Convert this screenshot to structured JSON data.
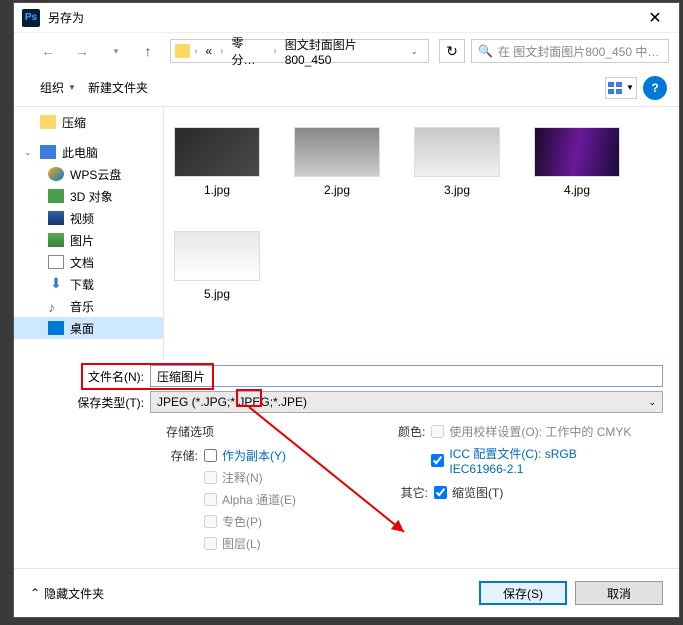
{
  "titlebar": {
    "title": "另存为",
    "app_icon": "Ps"
  },
  "nav": {
    "crumbs": [
      "«",
      "零分…",
      "图文封面图片800_450"
    ],
    "search_placeholder": "在 图文封面图片800_450 中…"
  },
  "toolbar": {
    "organize": "组织",
    "new_folder": "新建文件夹"
  },
  "sidebar": {
    "items": [
      {
        "label": "压缩",
        "icon": "folder",
        "level": "root"
      },
      {
        "label": "此电脑",
        "icon": "pc",
        "level": "root",
        "expandable": true
      },
      {
        "label": "WPS云盘",
        "icon": "cloud",
        "level": "child"
      },
      {
        "label": "3D 对象",
        "icon": "3d",
        "level": "child"
      },
      {
        "label": "视频",
        "icon": "video",
        "level": "child"
      },
      {
        "label": "图片",
        "icon": "pic",
        "level": "child"
      },
      {
        "label": "文档",
        "icon": "doc",
        "level": "child"
      },
      {
        "label": "下载",
        "icon": "dl",
        "level": "child"
      },
      {
        "label": "音乐",
        "icon": "music",
        "level": "child"
      },
      {
        "label": "桌面",
        "icon": "desktop",
        "level": "child",
        "selected": true
      }
    ]
  },
  "files": [
    {
      "name": "1.jpg",
      "thumb_class": "t1"
    },
    {
      "name": "2.jpg",
      "thumb_class": "t2"
    },
    {
      "name": "3.jpg",
      "thumb_class": "t3"
    },
    {
      "name": "4.jpg",
      "thumb_class": "t4"
    },
    {
      "name": "5.jpg",
      "thumb_class": "t5"
    }
  ],
  "form": {
    "filename_label": "文件名(N):",
    "filename_value": "压缩图片",
    "filetype_label": "保存类型(T):",
    "filetype_value": "JPEG (*.JPG;*.JPEG;*.JPE)"
  },
  "options": {
    "storage_title": "存储选项",
    "storage_label": "存储:",
    "as_copy": "作为副本(Y)",
    "annotations": "注释(N)",
    "alpha": "Alpha 通道(E)",
    "spot": "专色(P)",
    "layers": "图层(L)",
    "color_label": "颜色:",
    "use_proof": "使用校样设置(O): 工作中的 CMYK",
    "icc_profile": "ICC 配置文件(C): sRGB IEC61966-2.1",
    "other_label": "其它:",
    "thumbnail": "缩览图(T)"
  },
  "footer": {
    "hide_folders": "隐藏文件夹",
    "save": "保存(S)",
    "cancel": "取消"
  }
}
